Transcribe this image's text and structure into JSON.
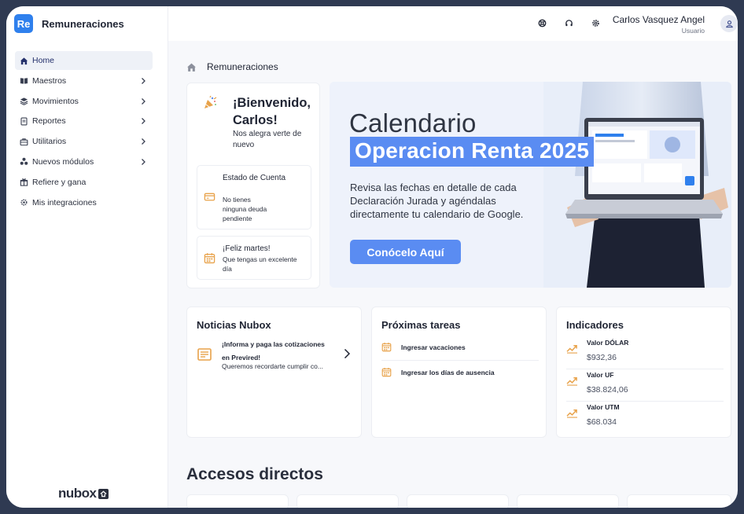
{
  "app": {
    "logo_text": "Re",
    "name": "Remuneraciones",
    "footer_brand": "nubox"
  },
  "sidebar": {
    "items": [
      {
        "label": "Home",
        "icon": "home-icon",
        "active": true,
        "chevron": false
      },
      {
        "label": "Maestros",
        "icon": "book-icon",
        "active": false,
        "chevron": true
      },
      {
        "label": "Movimientos",
        "icon": "stack-icon",
        "active": false,
        "chevron": true
      },
      {
        "label": "Reportes",
        "icon": "document-icon",
        "active": false,
        "chevron": true
      },
      {
        "label": "Utilitarios",
        "icon": "briefcase-icon",
        "active": false,
        "chevron": true
      },
      {
        "label": "Nuevos módulos",
        "icon": "modules-icon",
        "active": false,
        "chevron": true
      },
      {
        "label": "Refiere y gana",
        "icon": "gift-icon",
        "active": false,
        "chevron": false
      },
      {
        "label": "Mis integraciones",
        "icon": "gear-icon",
        "active": false,
        "chevron": false
      }
    ]
  },
  "header": {
    "icons": [
      "support-icon",
      "headset-icon",
      "settings-icon"
    ],
    "user_name": "Carlos Vasquez Angel",
    "user_role": "Usuario"
  },
  "breadcrumb": {
    "label": "Remuneraciones"
  },
  "welcome": {
    "title": "¡Bienvenido, Carlos!",
    "subtitle": "Nos alegra verte de nuevo",
    "account": {
      "title": "Estado de Cuenta",
      "text": "No tienes ninguna deuda pendiente"
    },
    "greeting": {
      "title": "¡Feliz martes!",
      "text": "Que tengas un excelente día"
    }
  },
  "banner": {
    "title": "Calendario",
    "highlight": "Operacion Renta 2025",
    "text": "Revisa las fechas en detalle de cada Declaración Jurada y agéndalas directamente tu calendario de Google.",
    "button": "Conócelo Aquí"
  },
  "news": {
    "title": "Noticias Nubox",
    "item_title": "¡Informa y paga las cotizaciones en Previred!",
    "item_text": "Queremos recordarte cumplir co..."
  },
  "tasks": {
    "title": "Próximas tareas",
    "items": [
      "Ingresar vacaciones",
      "Ingresar los días de ausencia"
    ]
  },
  "indicators": {
    "title": "Indicadores",
    "items": [
      {
        "label": "Valor DÓLAR",
        "value": "$932,36"
      },
      {
        "label": "Valor UF",
        "value": "$38.824,06"
      },
      {
        "label": "Valor UTM",
        "value": "$68.034"
      }
    ]
  },
  "quick_access": {
    "title": "Accesos directos"
  },
  "colors": {
    "accent": "#5a8cf2",
    "brand": "#2f80ed",
    "warning_icon": "#e8a24a"
  }
}
